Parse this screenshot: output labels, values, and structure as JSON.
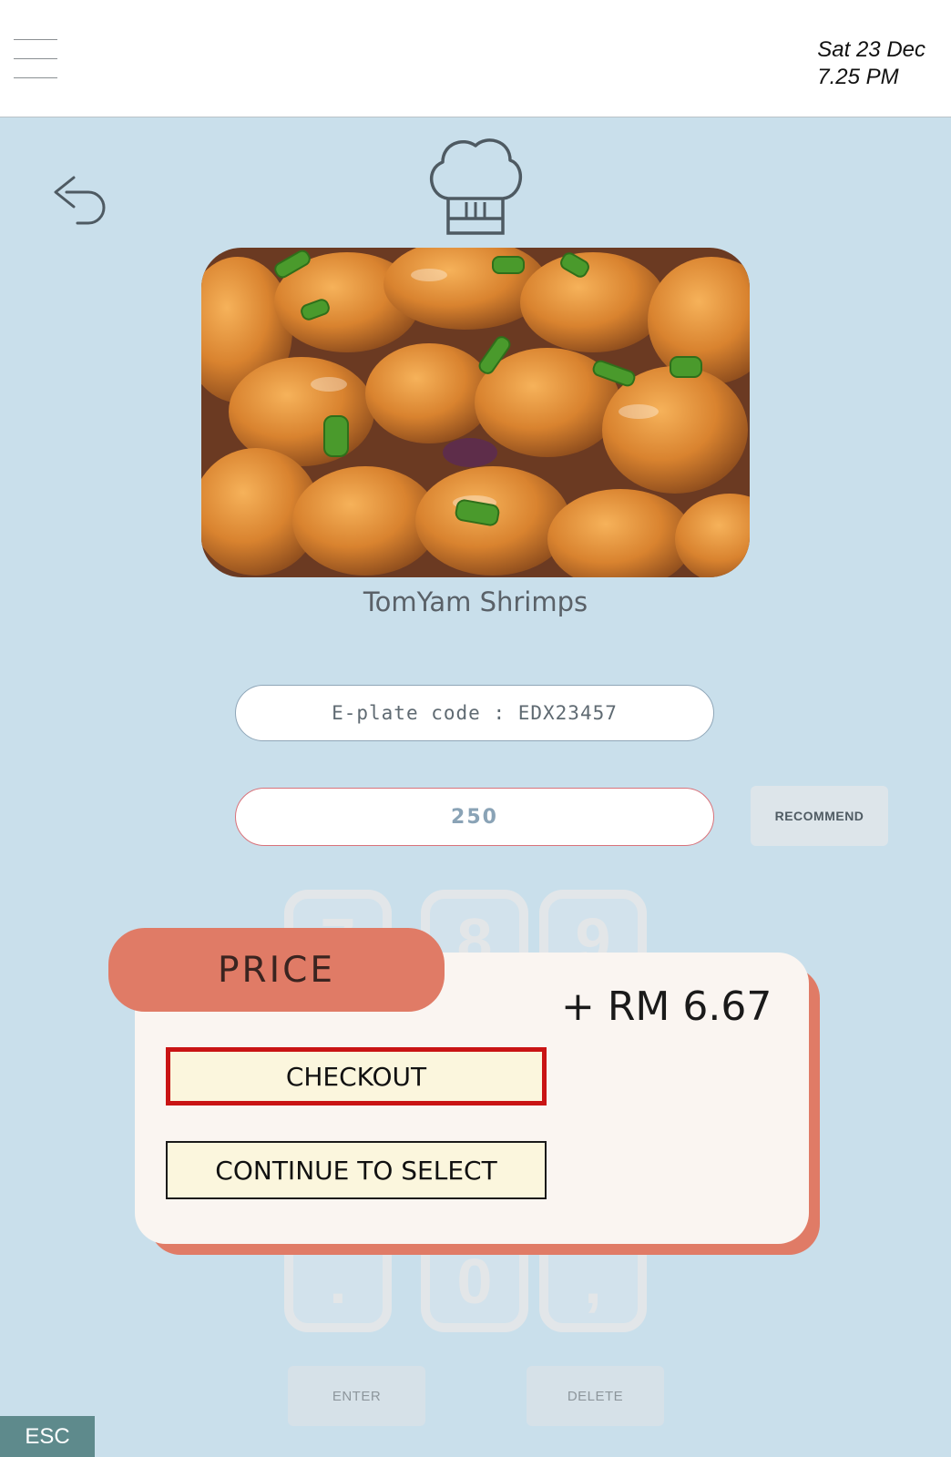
{
  "header": {
    "date": "Sat 23 Dec",
    "time": "7.25 PM"
  },
  "dish": {
    "name": "TomYam Shrimps"
  },
  "fields": {
    "eplate_code": "E-plate code : EDX23457",
    "weight_value": "250",
    "recommend_label": "RECOMMEND"
  },
  "keypad": {
    "top_keys": [
      "7",
      "8",
      "9"
    ],
    "bottom_keys": [
      ".",
      "0",
      ","
    ],
    "enter_label": "ENTER",
    "delete_label": "DELETE"
  },
  "modal": {
    "title": "PRICE",
    "amount": "+ RM 6.67",
    "checkout_label": "CHECKOUT",
    "continue_label": "CONTINUE TO SELECT"
  },
  "esc_label": "ESC",
  "colors": {
    "background": "#c9dfeb",
    "accent": "#e07b66",
    "checkout_border": "#c91414",
    "esc_bg": "#5e8a8c"
  },
  "icons": {
    "menu": "hamburger-icon",
    "back": "undo-arrow-icon",
    "chef": "chef-hat-icon"
  }
}
